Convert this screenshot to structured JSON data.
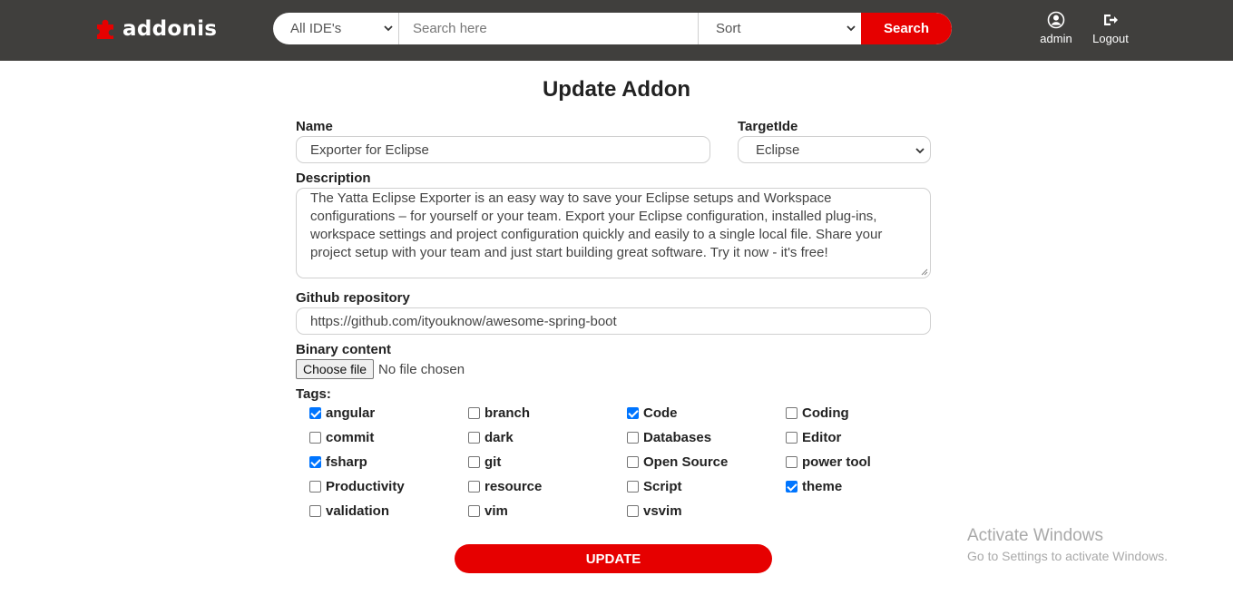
{
  "header": {
    "logo_text": "addonis",
    "ide_select": {
      "selected": "All IDE's"
    },
    "search": {
      "placeholder": "Search here"
    },
    "sort_select": {
      "selected": "Sort"
    },
    "search_button": "Search",
    "user_label": "admin",
    "logout_label": "Logout",
    "brand_color": "#e60000",
    "navbar_color": "#403f3d"
  },
  "form": {
    "title": "Update Addon",
    "name": {
      "label": "Name",
      "value": "Exporter for Eclipse"
    },
    "target_ide": {
      "label": "TargetIde",
      "selected": "Eclipse"
    },
    "description": {
      "label": "Description",
      "value": "The Yatta Eclipse Exporter is an easy way to save your Eclipse setups and Workspace configurations – for yourself or your team. Export your Eclipse configuration, installed plug-ins, workspace settings and project configuration quickly and easily to a single local file. Share your project setup with your team and just start building great software. Try it now - it's free!"
    },
    "github": {
      "label": "Github repository",
      "value": "https://github.com/ityouknow/awesome-spring-boot"
    },
    "binary": {
      "label": "Binary content",
      "button": "Choose file",
      "status": "No file chosen"
    },
    "tags_label": "Tags:",
    "tags": [
      {
        "label": "angular",
        "checked": true
      },
      {
        "label": "branch",
        "checked": false
      },
      {
        "label": "Code",
        "checked": true
      },
      {
        "label": "Coding",
        "checked": false
      },
      {
        "label": "commit",
        "checked": false
      },
      {
        "label": "dark",
        "checked": false
      },
      {
        "label": "Databases",
        "checked": false
      },
      {
        "label": "Editor",
        "checked": false
      },
      {
        "label": "fsharp",
        "checked": true
      },
      {
        "label": "git",
        "checked": false
      },
      {
        "label": "Open Source",
        "checked": false
      },
      {
        "label": "power tool",
        "checked": false
      },
      {
        "label": "Productivity",
        "checked": false
      },
      {
        "label": "resource",
        "checked": false
      },
      {
        "label": "Script",
        "checked": false
      },
      {
        "label": "theme",
        "checked": true
      },
      {
        "label": "validation",
        "checked": false
      },
      {
        "label": "vim",
        "checked": false
      },
      {
        "label": "vsvim",
        "checked": false
      }
    ],
    "update_button": "UPDATE"
  },
  "watermark": {
    "title": "Activate Windows",
    "subtitle": "Go to Settings to activate Windows."
  }
}
